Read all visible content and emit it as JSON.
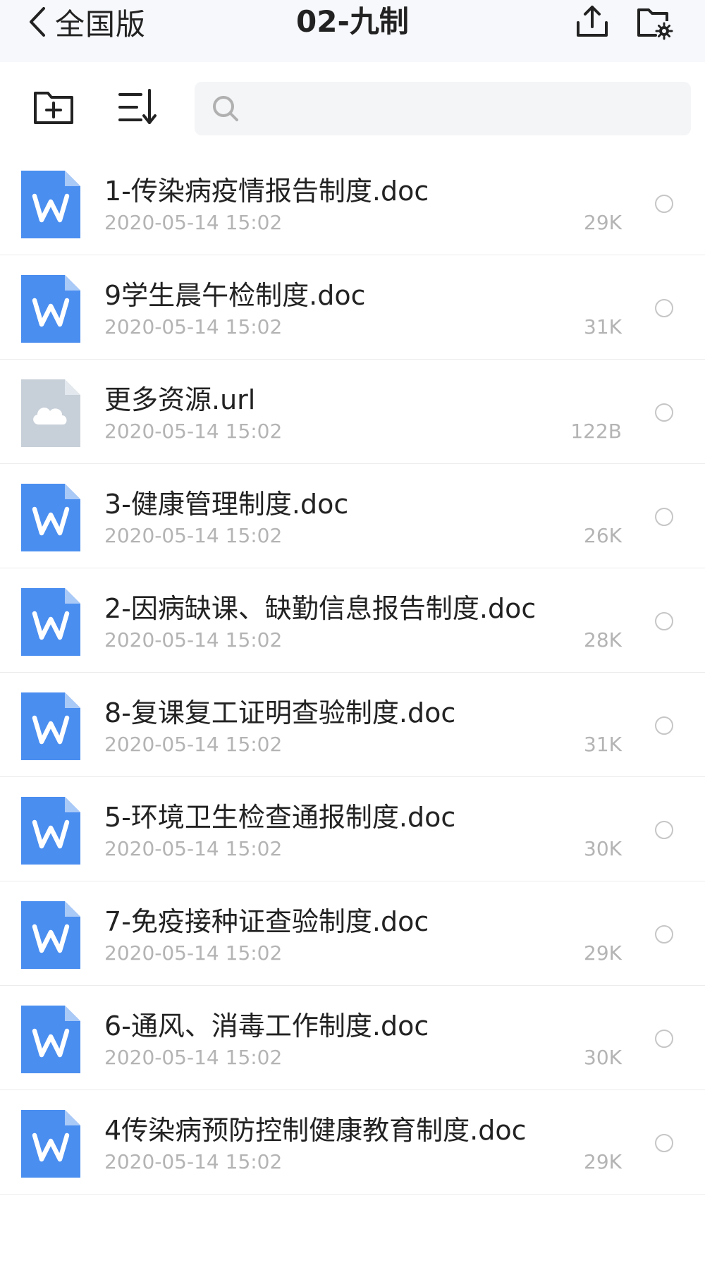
{
  "header": {
    "back_label": "全国版",
    "title": "02-九制"
  },
  "search": {
    "placeholder": ""
  },
  "colors": {
    "word_icon": "#4a8ef0",
    "word_icon_fold": "#a9c9f7",
    "cloud_icon_bg": "#c7cfd8",
    "meta_text": "#b4b4b4"
  },
  "files": [
    {
      "name": "1-传染病疫情报告制度.doc",
      "date": "2020-05-14 15:02",
      "size": "29K",
      "icon": "word-icon"
    },
    {
      "name": "9学生晨午检制度.doc",
      "date": "2020-05-14 15:02",
      "size": "31K",
      "icon": "word-icon"
    },
    {
      "name": "更多资源.url",
      "date": "2020-05-14 15:02",
      "size": "122B",
      "icon": "cloud-file-icon"
    },
    {
      "name": "3-健康管理制度.doc",
      "date": "2020-05-14 15:02",
      "size": "26K",
      "icon": "word-icon"
    },
    {
      "name": "2-因病缺课、缺勤信息报告制度.doc",
      "date": "2020-05-14 15:02",
      "size": "28K",
      "icon": "word-icon"
    },
    {
      "name": "8-复课复工证明查验制度.doc",
      "date": "2020-05-14 15:02",
      "size": "31K",
      "icon": "word-icon"
    },
    {
      "name": "5-环境卫生检查通报制度.doc",
      "date": "2020-05-14 15:02",
      "size": "30K",
      "icon": "word-icon"
    },
    {
      "name": "7-免疫接种证查验制度.doc",
      "date": "2020-05-14 15:02",
      "size": "29K",
      "icon": "word-icon"
    },
    {
      "name": "6-通风、消毒工作制度.doc",
      "date": "2020-05-14 15:02",
      "size": "30K",
      "icon": "word-icon"
    },
    {
      "name": "4传染病预防控制健康教育制度.doc",
      "date": "2020-05-14 15:02",
      "size": "29K",
      "icon": "word-icon"
    }
  ]
}
